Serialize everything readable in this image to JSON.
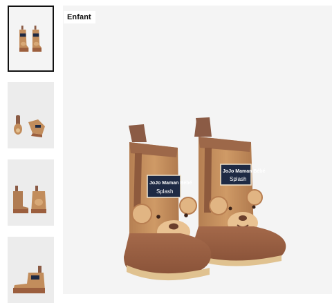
{
  "product": {
    "badge": "Enfant",
    "boot_label": {
      "line1": "JoJo Maman Bébé",
      "line2": "Splash"
    }
  },
  "gallery": {
    "thumbnails": [
      {
        "view": "front pair",
        "selected": true
      },
      {
        "view": "top and side",
        "selected": false
      },
      {
        "view": "back pair",
        "selected": false
      },
      {
        "view": "side single",
        "selected": false
      }
    ]
  },
  "colors": {
    "boot_body": "#c28d5c",
    "boot_sole": "#9c5f3e",
    "boot_shaft": "#8b5b45",
    "label_bg": "#1e2a44",
    "background": "#f4f4f4"
  },
  "icons": [
    "bear-face-icon",
    "splash-icon"
  ]
}
